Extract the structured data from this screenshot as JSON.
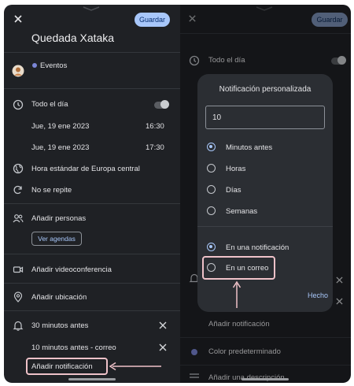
{
  "left": {
    "save_label": "Guardar",
    "title": "Quedada Xataka",
    "calendar_name": "Eventos",
    "all_day_label": "Todo el día",
    "start_date": "Jue, 19 ene 2023",
    "start_time": "16:30",
    "end_date": "Jue, 19 ene 2023",
    "end_time": "17:30",
    "timezone": "Hora estándar de Europa central",
    "repeat": "No se repite",
    "add_people": "Añadir personas",
    "view_calendars": "Ver agendas",
    "add_video": "Añadir videoconferencia",
    "add_location": "Añadir ubicación",
    "notifications": [
      "30 minutos antes",
      "10 minutos antes - correo"
    ],
    "add_notification": "Añadir notificación"
  },
  "right": {
    "save_label": "Guardar",
    "all_day_label": "Todo el día",
    "add_notification": "Añadir notificación",
    "default_color": "Color predeterminado",
    "add_description": "Añadir una descripción"
  },
  "dialog": {
    "title": "Notificación personalizada",
    "amount": "10",
    "units": [
      "Minutos antes",
      "Horas",
      "Días",
      "Semanas"
    ],
    "selected_unit": "Minutos antes",
    "methods": [
      "En una notificación",
      "En un correo"
    ],
    "selected_method": "En una notificación",
    "done_label": "Hecho"
  },
  "colors": {
    "background": "#1f2125",
    "accent": "#a8c7fa",
    "highlight": "#efc2c9",
    "calendar_dot": "#7b86d6"
  }
}
